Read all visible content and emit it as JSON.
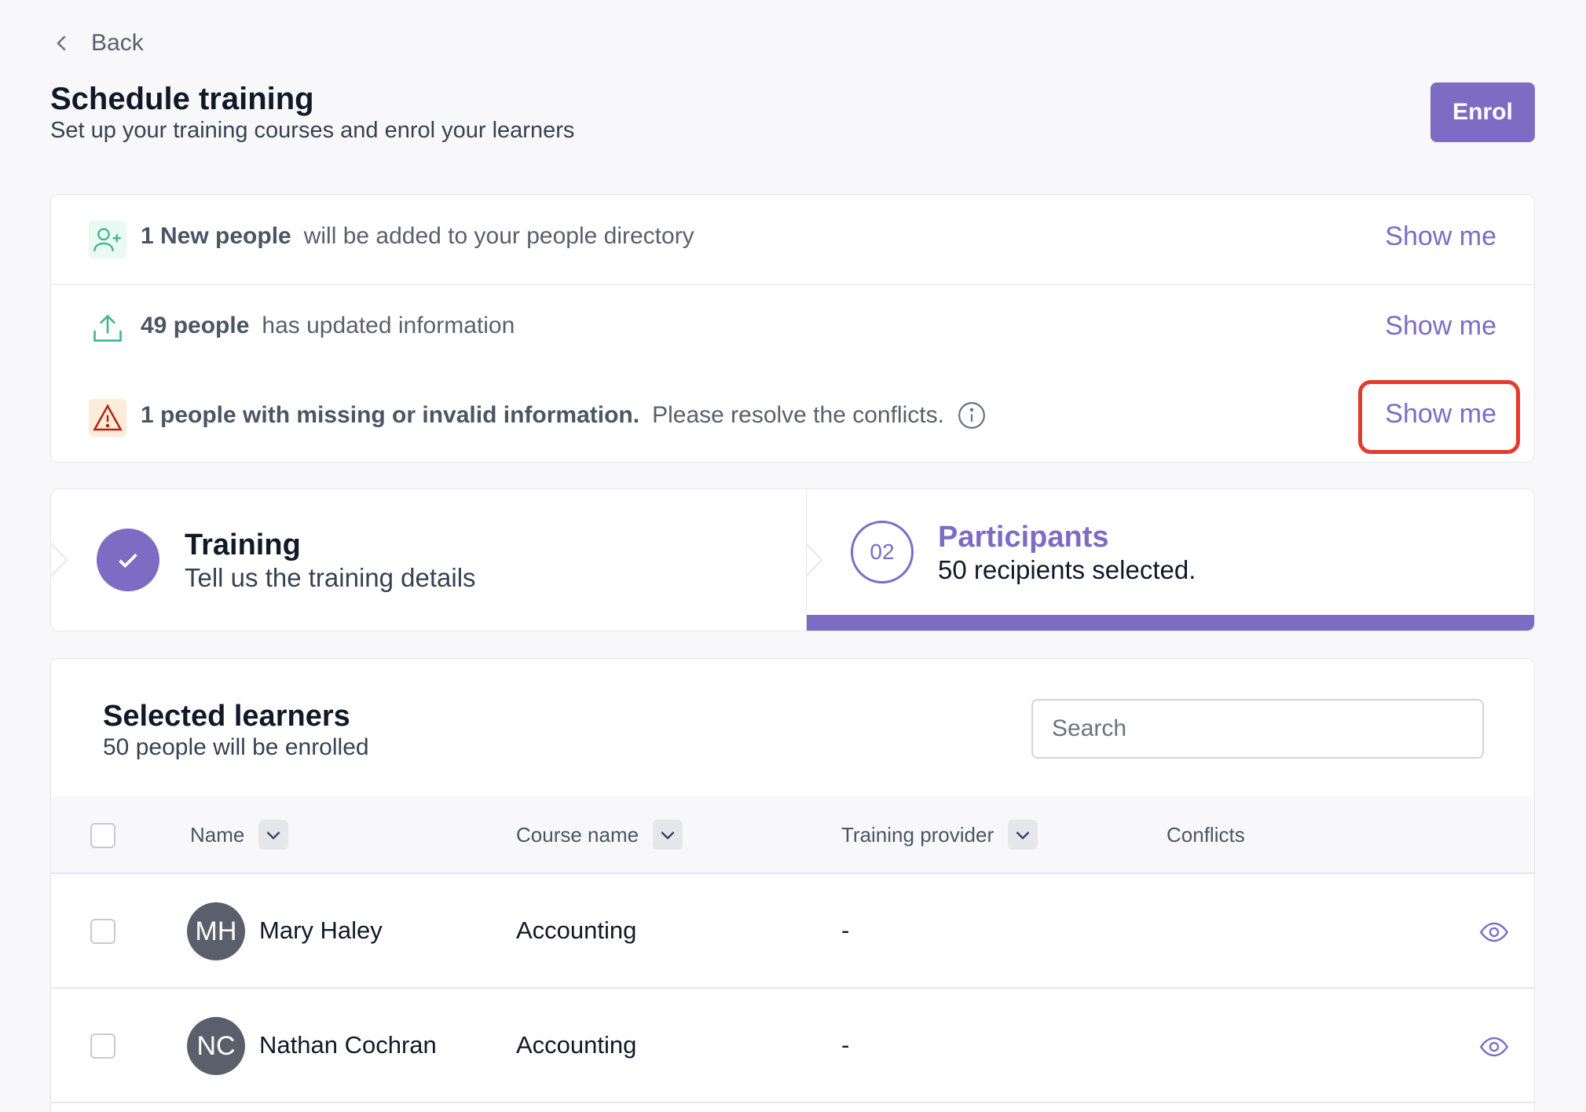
{
  "header": {
    "back_label": "Back",
    "title": "Schedule training",
    "subtitle": "Set up your training courses and enrol your learners",
    "enrol_label": "Enrol"
  },
  "notices": [
    {
      "icon": "user-plus-icon",
      "strong": "1 New people",
      "text": "will be added to your people directory",
      "action": "Show me"
    },
    {
      "icon": "upload-icon",
      "strong": "49 people",
      "text": "has updated information",
      "action": "Show me"
    },
    {
      "icon": "warning-icon",
      "strong": "1 people with missing or invalid information.",
      "text": "Please resolve the conflicts.",
      "action": "Show me"
    }
  ],
  "steps": [
    {
      "title": "Training",
      "description": "Tell us the training details",
      "status": "complete"
    },
    {
      "number": "02",
      "title": "Participants",
      "description": "50 recipients selected.",
      "status": "active"
    }
  ],
  "learners": {
    "title": "Selected learners",
    "subtitle": "50 people will be enrolled",
    "search_placeholder": "Search",
    "columns": {
      "name": "Name",
      "course": "Course name",
      "provider": "Training provider",
      "conflicts": "Conflicts"
    },
    "rows": [
      {
        "initials": "MH",
        "name": "Mary Haley",
        "course": "Accounting",
        "provider": "-"
      },
      {
        "initials": "NC",
        "name": "Nathan Cochran",
        "course": "Accounting",
        "provider": "-"
      }
    ]
  },
  "colors": {
    "accent": "#7c6cc4",
    "highlight": "#e53b2c",
    "success": "#3fb68b",
    "warning": "#b42318"
  }
}
